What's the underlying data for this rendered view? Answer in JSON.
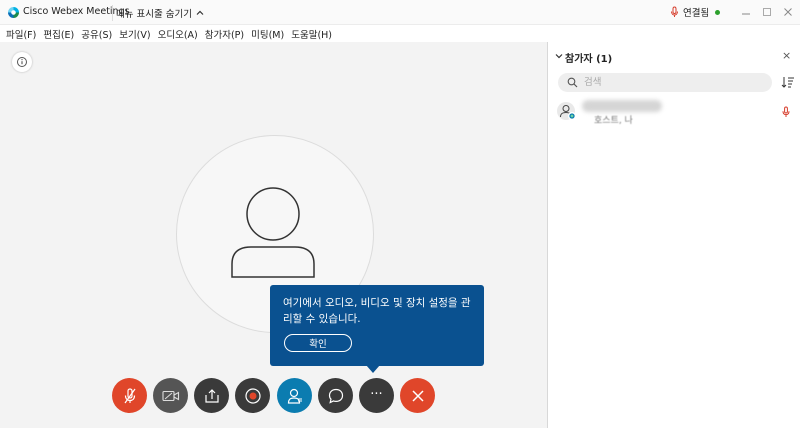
{
  "titlebar": {
    "app_title": "Cisco Webex Meetings",
    "menu_toggle_label": "메뉴 표시줄 숨기기",
    "status_label": "연결됨",
    "status_color": "#2ca02c"
  },
  "menubar": {
    "items": [
      {
        "label": "파일(F)"
      },
      {
        "label": "편집(E)"
      },
      {
        "label": "공유(S)"
      },
      {
        "label": "보기(V)"
      },
      {
        "label": "오디오(A)"
      },
      {
        "label": "참가자(P)"
      },
      {
        "label": "미팅(M)"
      },
      {
        "label": "도움말(H)"
      }
    ]
  },
  "tooltip": {
    "message": "여기에서 오디오, 비디오 및 장치 설정을 관리할 수 있습니다.",
    "confirm_label": "확인",
    "background": "#0a5190"
  },
  "controls": {
    "mute_color": "#e0462a",
    "video_color": "#555555",
    "share_color": "#3a3a3a",
    "record_color": "#3a3a3a",
    "participants_color": "#0b7cb0",
    "chat_color": "#3a3a3a",
    "more_color": "#3a3a3a",
    "end_color": "#e0462a",
    "more_glyph": "···"
  },
  "panel": {
    "title": "참가자 (1)",
    "close_glyph": "×",
    "search_placeholder": "검색",
    "participants": [
      {
        "role": "호스트, 나"
      }
    ]
  }
}
